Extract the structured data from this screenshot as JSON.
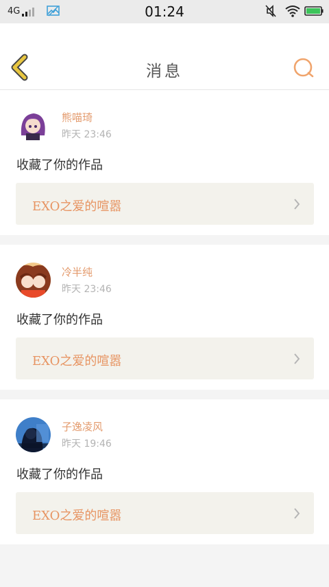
{
  "status_bar": {
    "network": "4G",
    "time": "01:24"
  },
  "header": {
    "title": "消息"
  },
  "colors": {
    "accent_orange": "#e79462",
    "back_arrow_yellow": "#e8c640",
    "back_arrow_outline": "#555555",
    "battery_green": "#3cc45a"
  },
  "messages": [
    {
      "username": "熊喵琦",
      "timestamp": "昨天 23:46",
      "action": "收藏了你的作品",
      "work_title": "EXO之爱的喧嚣"
    },
    {
      "username": "冷半纯",
      "timestamp": "昨天 23:46",
      "action": "收藏了你的作品",
      "work_title": "EXO之爱的喧嚣"
    },
    {
      "username": "子逸凌风",
      "timestamp": "昨天 19:46",
      "action": "收藏了你的作品",
      "work_title": "EXO之爱的喧嚣"
    }
  ]
}
